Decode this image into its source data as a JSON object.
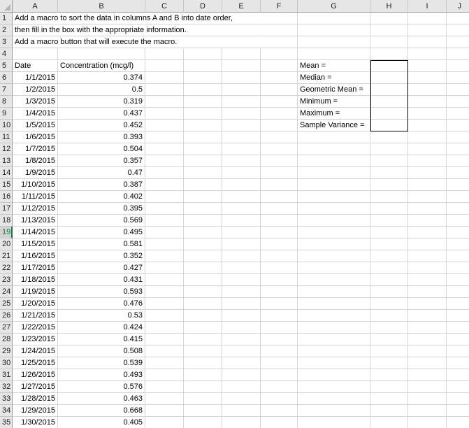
{
  "columns": [
    "A",
    "B",
    "C",
    "D",
    "E",
    "F",
    "G",
    "H",
    "I",
    "J"
  ],
  "instructions": [
    "Add a macro to sort the data in columns A and B into date order,",
    "then fill in the box with the appropriate information.",
    "Add a macro button that will execute the macro."
  ],
  "headers": {
    "date": "Date",
    "concentration": "Concentration (mcg/l)"
  },
  "rows": [
    [
      "1/1/2015",
      "0.374"
    ],
    [
      "1/2/2015",
      "0.5"
    ],
    [
      "1/3/2015",
      "0.319"
    ],
    [
      "1/4/2015",
      "0.437"
    ],
    [
      "1/5/2015",
      "0.452"
    ],
    [
      "1/6/2015",
      "0.393"
    ],
    [
      "1/7/2015",
      "0.504"
    ],
    [
      "1/8/2015",
      "0.357"
    ],
    [
      "1/9/2015",
      "0.47"
    ],
    [
      "1/10/2015",
      "0.387"
    ],
    [
      "1/11/2015",
      "0.402"
    ],
    [
      "1/12/2015",
      "0.395"
    ],
    [
      "1/13/2015",
      "0.569"
    ],
    [
      "1/14/2015",
      "0.495"
    ],
    [
      "1/15/2015",
      "0.581"
    ],
    [
      "1/16/2015",
      "0.352"
    ],
    [
      "1/17/2015",
      "0.427"
    ],
    [
      "1/18/2015",
      "0.431"
    ],
    [
      "1/19/2015",
      "0.593"
    ],
    [
      "1/20/2015",
      "0.476"
    ],
    [
      "1/21/2015",
      "0.53"
    ],
    [
      "1/22/2015",
      "0.424"
    ],
    [
      "1/23/2015",
      "0.415"
    ],
    [
      "1/24/2015",
      "0.508"
    ],
    [
      "1/25/2015",
      "0.539"
    ],
    [
      "1/26/2015",
      "0.493"
    ],
    [
      "1/27/2015",
      "0.576"
    ],
    [
      "1/28/2015",
      "0.463"
    ],
    [
      "1/29/2015",
      "0.668"
    ],
    [
      "1/30/2015",
      "0.405"
    ]
  ],
  "stats_labels": [
    "Mean =",
    "Median =",
    "Geometric Mean =",
    "Minimum =",
    "Maximum =",
    "Sample Variance ="
  ],
  "selected_row": "19"
}
